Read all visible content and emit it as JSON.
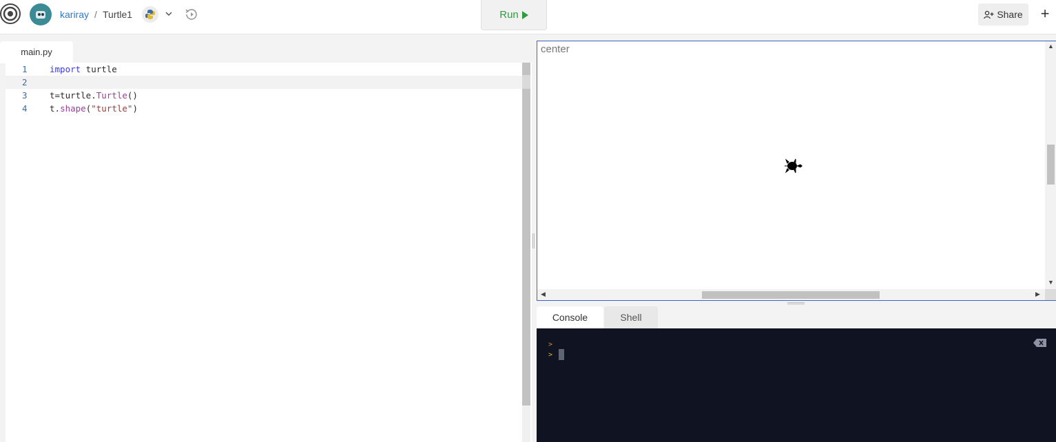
{
  "topbar": {
    "user": "kariray",
    "separator": "/",
    "project": "Turtle1",
    "run_label": "Run",
    "share_label": "Share",
    "plus_label": "+"
  },
  "editor": {
    "tab_label": "main.py",
    "lines": [
      {
        "num": "1",
        "text": "import turtle"
      },
      {
        "num": "2",
        "text": ""
      },
      {
        "num": "3",
        "text": "t=turtle.Turtle()"
      },
      {
        "num": "4",
        "text": "t.shape(\"turtle\")"
      }
    ]
  },
  "canvas": {
    "title": "center"
  },
  "console": {
    "tabs": [
      "Console",
      "Shell"
    ],
    "prompt1": ">",
    "prompt2": ">"
  },
  "colors": {
    "run_green": "#2e9c3f",
    "link_blue": "#2e79c9",
    "console_bg": "#0f1322",
    "canvas_border": "#3b63c4"
  }
}
